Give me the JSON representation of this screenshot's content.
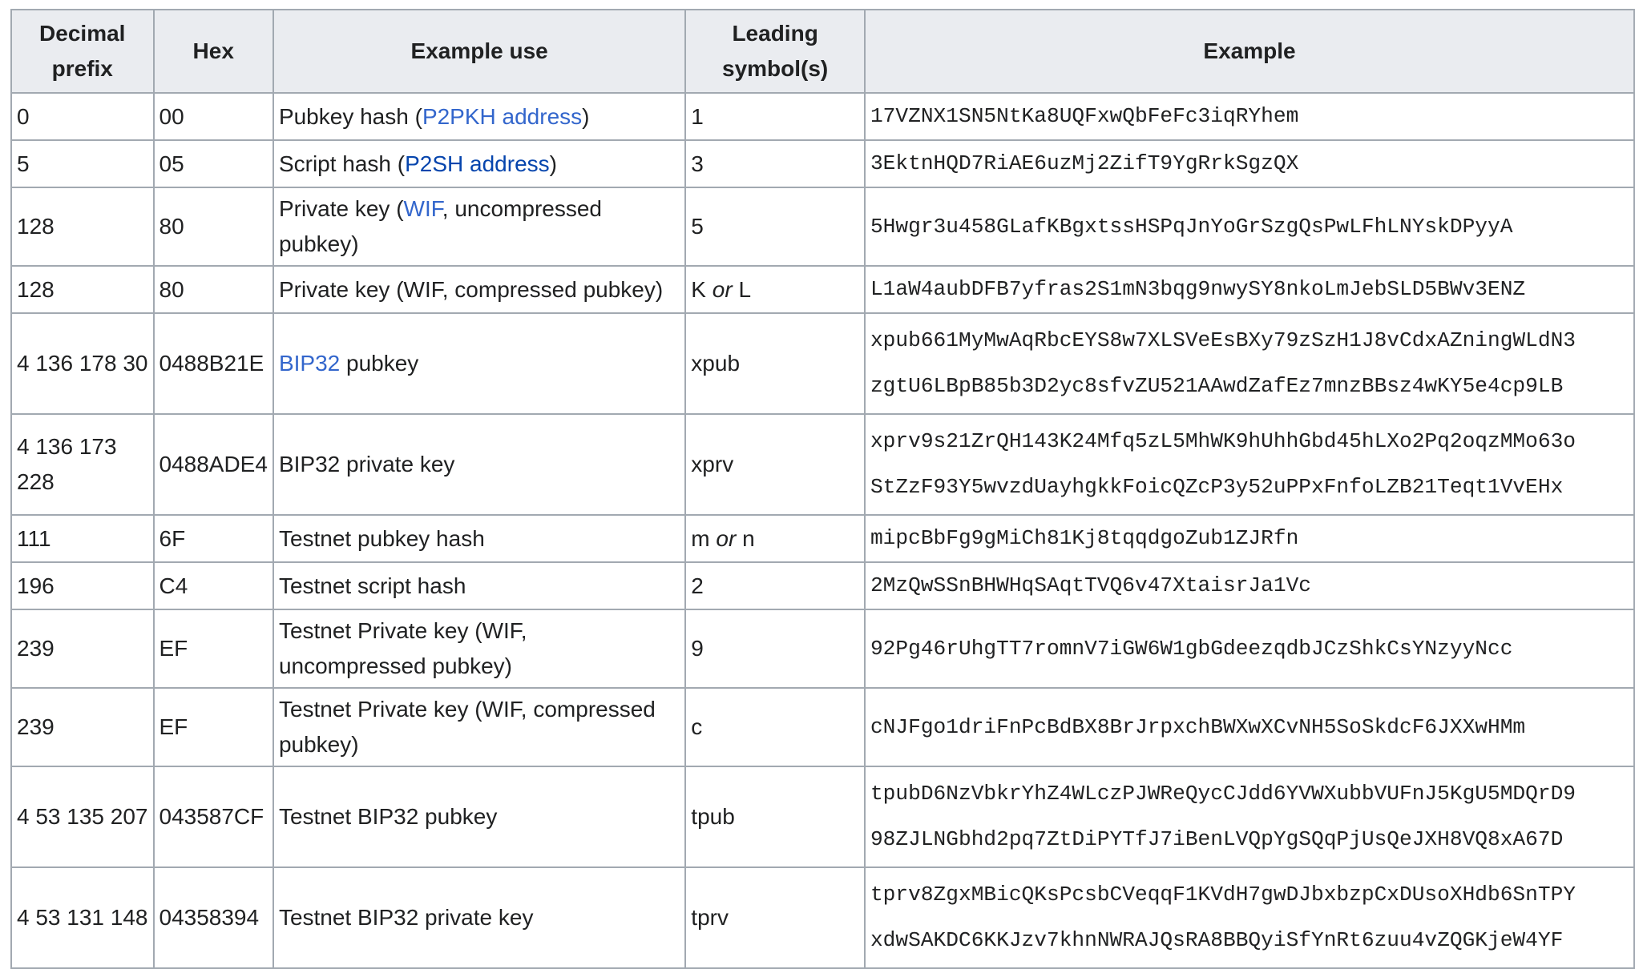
{
  "headers": {
    "decimal": "Decimal prefix",
    "hex": "Hex",
    "use": "Example use",
    "leading": "Leading symbol(s)",
    "example": "Example"
  },
  "rows": [
    {
      "decimal": "0",
      "hex": "00",
      "use_pre": "Pubkey hash (",
      "use_link": "P2PKH address",
      "use_post": ")",
      "lead": "1",
      "example": [
        "17VZNX1SN5NtKa8UQFxwQbFeFc3iqRYhem"
      ]
    },
    {
      "decimal": "5",
      "hex": "05",
      "use_pre": "Script hash (",
      "use_link": "P2SH address",
      "use_post": ")",
      "lead": "3",
      "example": [
        "3EktnHQD7RiAE6uzMj2ZifT9YgRrkSgzQX"
      ]
    },
    {
      "decimal": "128",
      "hex": "80",
      "use_pre": "Private key (",
      "use_link": "WIF",
      "use_post": ", uncompressed pubkey)",
      "lead": "5",
      "example": [
        "5Hwgr3u458GLafKBgxtssHSPqJnYoGrSzgQsPwLFhLNYskDPyyA"
      ]
    },
    {
      "decimal": "128",
      "hex": "80",
      "use_pre": "Private key (WIF, compressed pubkey)",
      "use_link": "",
      "use_post": "",
      "lead_a": "K",
      "lead_or": "or",
      "lead_b": "L",
      "example": [
        "L1aW4aubDFB7yfras2S1mN3bqg9nwySY8nkoLmJebSLD5BWv3ENZ"
      ]
    },
    {
      "decimal": "4 136 178 30",
      "hex": "0488B21E",
      "use_pre": "",
      "use_link": "BIP32",
      "use_post": " pubkey",
      "lead": "xpub",
      "example": [
        "xpub661MyMwAqRbcEYS8w7XLSVeEsBXy79zSzH1J8vCdxAZningWLdN3",
        "zgtU6LBpB85b3D2yc8sfvZU521AAwdZafEz7mnzBBsz4wKY5e4cp9LB"
      ]
    },
    {
      "decimal": "4 136 173 228",
      "hex": "0488ADE4",
      "use_pre": "BIP32 private key",
      "use_link": "",
      "use_post": "",
      "lead": "xprv",
      "example": [
        "xprv9s21ZrQH143K24Mfq5zL5MhWK9hUhhGbd45hLXo2Pq2oqzMMo63o",
        "StZzF93Y5wvzdUayhgkkFoicQZcP3y52uPPxFnfoLZB21Teqt1VvEHx"
      ]
    },
    {
      "decimal": "111",
      "hex": "6F",
      "use_pre": "Testnet pubkey hash",
      "use_link": "",
      "use_post": "",
      "lead_a": "m",
      "lead_or": "or",
      "lead_b": "n",
      "example": [
        "mipcBbFg9gMiCh81Kj8tqqdgoZub1ZJRfn"
      ]
    },
    {
      "decimal": "196",
      "hex": "C4",
      "use_pre": "Testnet script hash",
      "use_link": "",
      "use_post": "",
      "lead": "2",
      "example": [
        "2MzQwSSnBHWHqSAqtTVQ6v47XtaisrJa1Vc"
      ]
    },
    {
      "decimal": "239",
      "hex": "EF",
      "use_pre": "Testnet Private key (WIF, uncompressed pubkey)",
      "use_link": "",
      "use_post": "",
      "lead": "9",
      "example": [
        "92Pg46rUhgTT7romnV7iGW6W1gbGdeezqdbJCzShkCsYNzyyNcc"
      ]
    },
    {
      "decimal": "239",
      "hex": "EF",
      "use_pre": "Testnet Private key (WIF, compressed pubkey)",
      "use_link": "",
      "use_post": "",
      "lead": "c",
      "example": [
        "cNJFgo1driFnPcBdBX8BrJrpxchBWXwXCvNH5SoSkdcF6JXXwHMm"
      ]
    },
    {
      "decimal": "4 53 135 207",
      "hex": "043587CF",
      "use_pre": "Testnet BIP32 pubkey",
      "use_link": "",
      "use_post": "",
      "lead": "tpub",
      "example": [
        "tpubD6NzVbkrYhZ4WLczPJWReQycCJdd6YVWXubbVUFnJ5KgU5MDQrD9",
        "98ZJLNGbhd2pq7ZtDiPYTfJ7iBenLVQpYgSQqPjUsQeJXH8VQ8xA67D"
      ]
    },
    {
      "decimal": "4 53 131 148",
      "hex": "04358394",
      "use_pre": "Testnet BIP32 private key",
      "use_link": "",
      "use_post": "",
      "lead": "tprv",
      "example": [
        "tprv8ZgxMBicQKsPcsbCVeqqF1KVdH7gwDJbxbzpCxDUsoXHdb6SnTPY",
        "xdwSAKDC6KKJzv7khnNWRAJQsRA8BBQyiSfYnRt6zuu4vZQGKjeW4YF"
      ]
    }
  ]
}
